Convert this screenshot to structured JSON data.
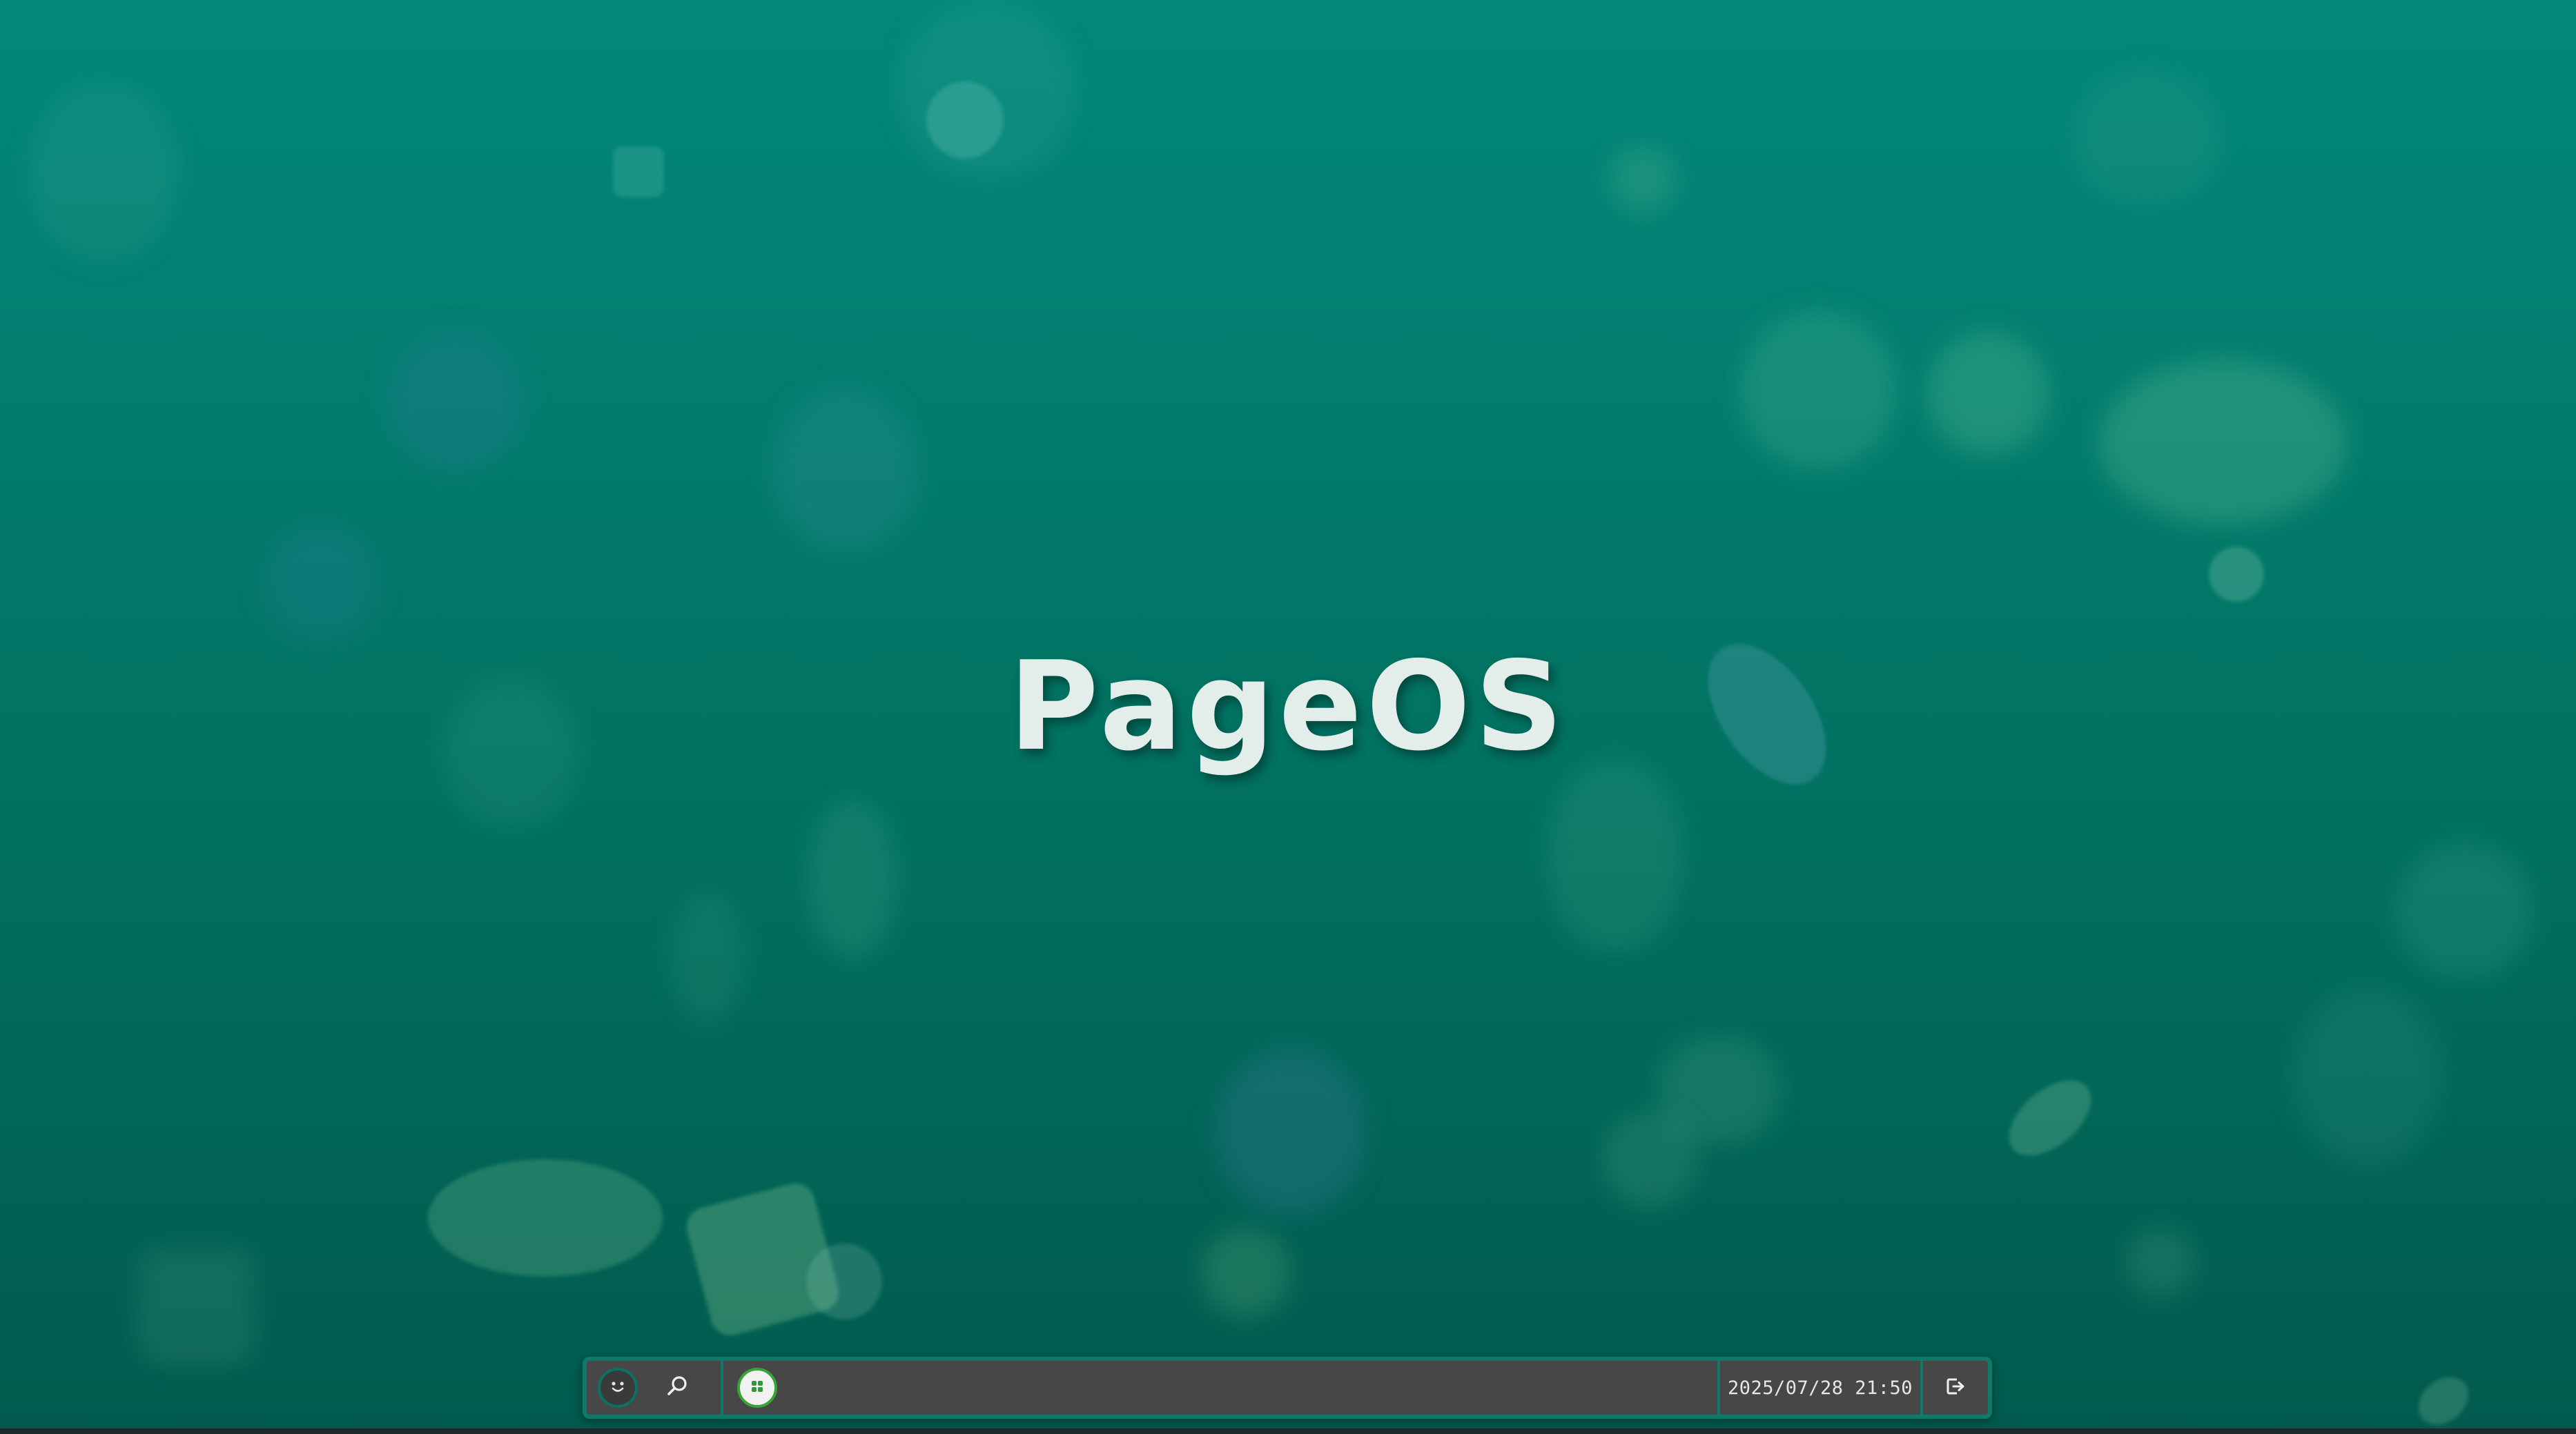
{
  "desktop": {
    "brand_title": "PageOS",
    "background_color": "#027868"
  },
  "taskbar": {
    "start_icon": "smiley-face-icon",
    "search_icon": "search-icon",
    "pinned_apps": [
      {
        "icon": "app-launcher-icon",
        "accent": "#3aa336"
      }
    ],
    "clock": "2025/07/28 21:50",
    "logout_icon": "logout-icon",
    "border_color": "#0f7a6a",
    "background_color": "#474747"
  }
}
